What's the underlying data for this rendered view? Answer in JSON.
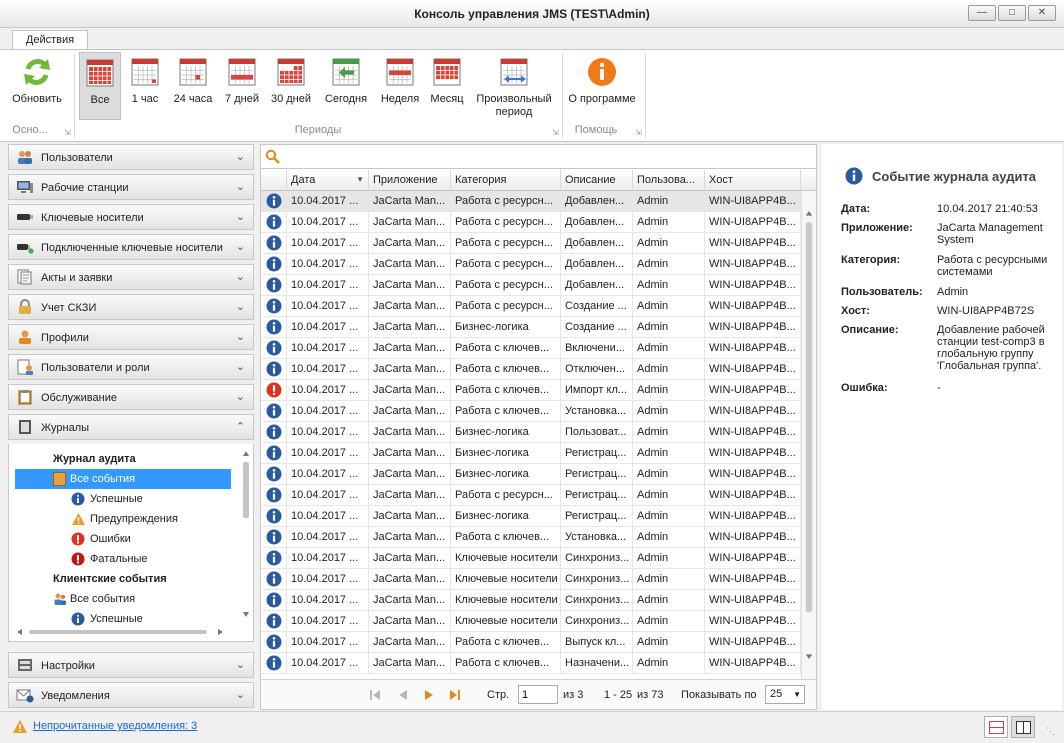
{
  "window": {
    "title": "Консоль управления JMS (TEST\\Admin)"
  },
  "ribbon": {
    "tab": "Действия",
    "buttons": {
      "refresh": "Обновить",
      "all": "Все",
      "h1": "1 час",
      "h24": "24 часа",
      "d7": "7 дней",
      "d30": "30 дней",
      "today": "Сегодня",
      "week": "Неделя",
      "month": "Месяц",
      "custom_line1": "Произвольный",
      "custom_line2": "период",
      "about": "О программе"
    },
    "groups": {
      "basic": "Осно...",
      "periods": "Периоды",
      "help": "Помощь"
    }
  },
  "nav": {
    "items": [
      "Пользователи",
      "Рабочие станции",
      "Ключевые носители",
      "Подключенные ключевые носители",
      "Акты и заявки",
      "Учет СКЗИ",
      "Профили",
      "Пользователи и роли",
      "Обслуживание",
      "Журналы"
    ],
    "tree": {
      "audit_header": "Журнал аудита",
      "all_events": "Все события",
      "success": "Успешные",
      "warnings": "Предупреждения",
      "errors": "Ошибки",
      "fatal": "Фатальные",
      "client_header": "Клиентские события",
      "client_all": "Все события",
      "client_success": "Успешные"
    },
    "bottom": [
      "Настройки",
      "Уведомления"
    ]
  },
  "grid": {
    "columns": [
      "Дата",
      "Приложение",
      "Категория",
      "Описание",
      "Пользова...",
      "Хост"
    ],
    "rows": [
      {
        "level": "info",
        "date": "10.04.2017 ...",
        "app": "JaCarta Man...",
        "category": "Работа с ресурсн...",
        "desc": "Добавлен...",
        "user": "Admin",
        "host": "WIN-UI8APP4B..."
      },
      {
        "level": "info",
        "date": "10.04.2017 ...",
        "app": "JaCarta Man...",
        "category": "Работа с ресурсн...",
        "desc": "Добавлен...",
        "user": "Admin",
        "host": "WIN-UI8APP4B..."
      },
      {
        "level": "info",
        "date": "10.04.2017 ...",
        "app": "JaCarta Man...",
        "category": "Работа с ресурсн...",
        "desc": "Добавлен...",
        "user": "Admin",
        "host": "WIN-UI8APP4B..."
      },
      {
        "level": "info",
        "date": "10.04.2017 ...",
        "app": "JaCarta Man...",
        "category": "Работа с ресурсн...",
        "desc": "Добавлен...",
        "user": "Admin",
        "host": "WIN-UI8APP4B..."
      },
      {
        "level": "info",
        "date": "10.04.2017 ...",
        "app": "JaCarta Man...",
        "category": "Работа с ресурсн...",
        "desc": "Добавлен...",
        "user": "Admin",
        "host": "WIN-UI8APP4B..."
      },
      {
        "level": "info",
        "date": "10.04.2017 ...",
        "app": "JaCarta Man...",
        "category": "Работа с ресурсн...",
        "desc": "Создание ...",
        "user": "Admin",
        "host": "WIN-UI8APP4B..."
      },
      {
        "level": "info",
        "date": "10.04.2017 ...",
        "app": "JaCarta Man...",
        "category": "Бизнес-логика",
        "desc": "Создание ...",
        "user": "Admin",
        "host": "WIN-UI8APP4B..."
      },
      {
        "level": "info",
        "date": "10.04.2017 ...",
        "app": "JaCarta Man...",
        "category": "Работа с ключев...",
        "desc": "Включени...",
        "user": "Admin",
        "host": "WIN-UI8APP4B..."
      },
      {
        "level": "info",
        "date": "10.04.2017 ...",
        "app": "JaCarta Man...",
        "category": "Работа с ключев...",
        "desc": "Отключен...",
        "user": "Admin",
        "host": "WIN-UI8APP4B..."
      },
      {
        "level": "error",
        "date": "10.04.2017 ...",
        "app": "JaCarta Man...",
        "category": "Работа с ключев...",
        "desc": "Импорт кл...",
        "user": "Admin",
        "host": "WIN-UI8APP4B..."
      },
      {
        "level": "info",
        "date": "10.04.2017 ...",
        "app": "JaCarta Man...",
        "category": "Работа с ключев...",
        "desc": "Установка...",
        "user": "Admin",
        "host": "WIN-UI8APP4B..."
      },
      {
        "level": "info",
        "date": "10.04.2017 ...",
        "app": "JaCarta Man...",
        "category": "Бизнес-логика",
        "desc": "Пользоват...",
        "user": "Admin",
        "host": "WIN-UI8APP4B..."
      },
      {
        "level": "info",
        "date": "10.04.2017 ...",
        "app": "JaCarta Man...",
        "category": "Бизнес-логика",
        "desc": "Регистрац...",
        "user": "Admin",
        "host": "WIN-UI8APP4B..."
      },
      {
        "level": "info",
        "date": "10.04.2017 ...",
        "app": "JaCarta Man...",
        "category": "Бизнес-логика",
        "desc": "Регистрац...",
        "user": "Admin",
        "host": "WIN-UI8APP4B..."
      },
      {
        "level": "info",
        "date": "10.04.2017 ...",
        "app": "JaCarta Man...",
        "category": "Работа с ресурсн...",
        "desc": "Регистрац...",
        "user": "Admin",
        "host": "WIN-UI8APP4B..."
      },
      {
        "level": "info",
        "date": "10.04.2017 ...",
        "app": "JaCarta Man...",
        "category": "Бизнес-логика",
        "desc": "Регистрац...",
        "user": "Admin",
        "host": "WIN-UI8APP4B..."
      },
      {
        "level": "info",
        "date": "10.04.2017 ...",
        "app": "JaCarta Man...",
        "category": "Работа с ключев...",
        "desc": "Установка...",
        "user": "Admin",
        "host": "WIN-UI8APP4B..."
      },
      {
        "level": "info",
        "date": "10.04.2017 ...",
        "app": "JaCarta Man...",
        "category": "Ключевые носители",
        "desc": "Синхрониз...",
        "user": "Admin",
        "host": "WIN-UI8APP4B..."
      },
      {
        "level": "info",
        "date": "10.04.2017 ...",
        "app": "JaCarta Man...",
        "category": "Ключевые носители",
        "desc": "Синхрониз...",
        "user": "Admin",
        "host": "WIN-UI8APP4B..."
      },
      {
        "level": "info",
        "date": "10.04.2017 ...",
        "app": "JaCarta Man...",
        "category": "Ключевые носители",
        "desc": "Синхрониз...",
        "user": "Admin",
        "host": "WIN-UI8APP4B..."
      },
      {
        "level": "info",
        "date": "10.04.2017 ...",
        "app": "JaCarta Man...",
        "category": "Ключевые носители",
        "desc": "Синхрониз...",
        "user": "Admin",
        "host": "WIN-UI8APP4B..."
      },
      {
        "level": "info",
        "date": "10.04.2017 ...",
        "app": "JaCarta Man...",
        "category": "Работа с ключев...",
        "desc": "Выпуск кл...",
        "user": "Admin",
        "host": "WIN-UI8APP4B..."
      },
      {
        "level": "info",
        "date": "10.04.2017 ...",
        "app": "JaCarta Man...",
        "category": "Работа с ключев...",
        "desc": "Назначени...",
        "user": "Admin",
        "host": "WIN-UI8APP4B..."
      }
    ]
  },
  "pager": {
    "page_label": "Стр.",
    "page_value": "1",
    "of_pages": "из 3",
    "range": "1 - 25",
    "of_total": "из 73",
    "show_label": "Показывать по",
    "page_size": "25"
  },
  "detail": {
    "title": "Событие журнала аудита",
    "fields": [
      {
        "label": "Дата:",
        "value": "10.04.2017 21:40:53"
      },
      {
        "label": "Приложение:",
        "value": "JaCarta Management System"
      },
      {
        "label": "Категория:",
        "value": "Работа с ресурсными системами"
      },
      {
        "label": "Пользователь:",
        "value": "Admin"
      },
      {
        "label": "Хост:",
        "value": "WIN-UI8APP4B72S"
      },
      {
        "label": "Описание:",
        "value": "Добавление рабочей станции test-comp3 в глобальную группу 'Глобальная группа'."
      },
      {
        "label": "Ошибка:",
        "value": "-"
      }
    ]
  },
  "status": {
    "notifications_link": "Непрочитанные уведомления: 3"
  },
  "colors": {
    "selection": "#3399ff",
    "info_icon": "#2a5aa0",
    "error_icon": "#e0301e",
    "about_icon": "#f07a1a",
    "link": "#1a6ad6"
  }
}
